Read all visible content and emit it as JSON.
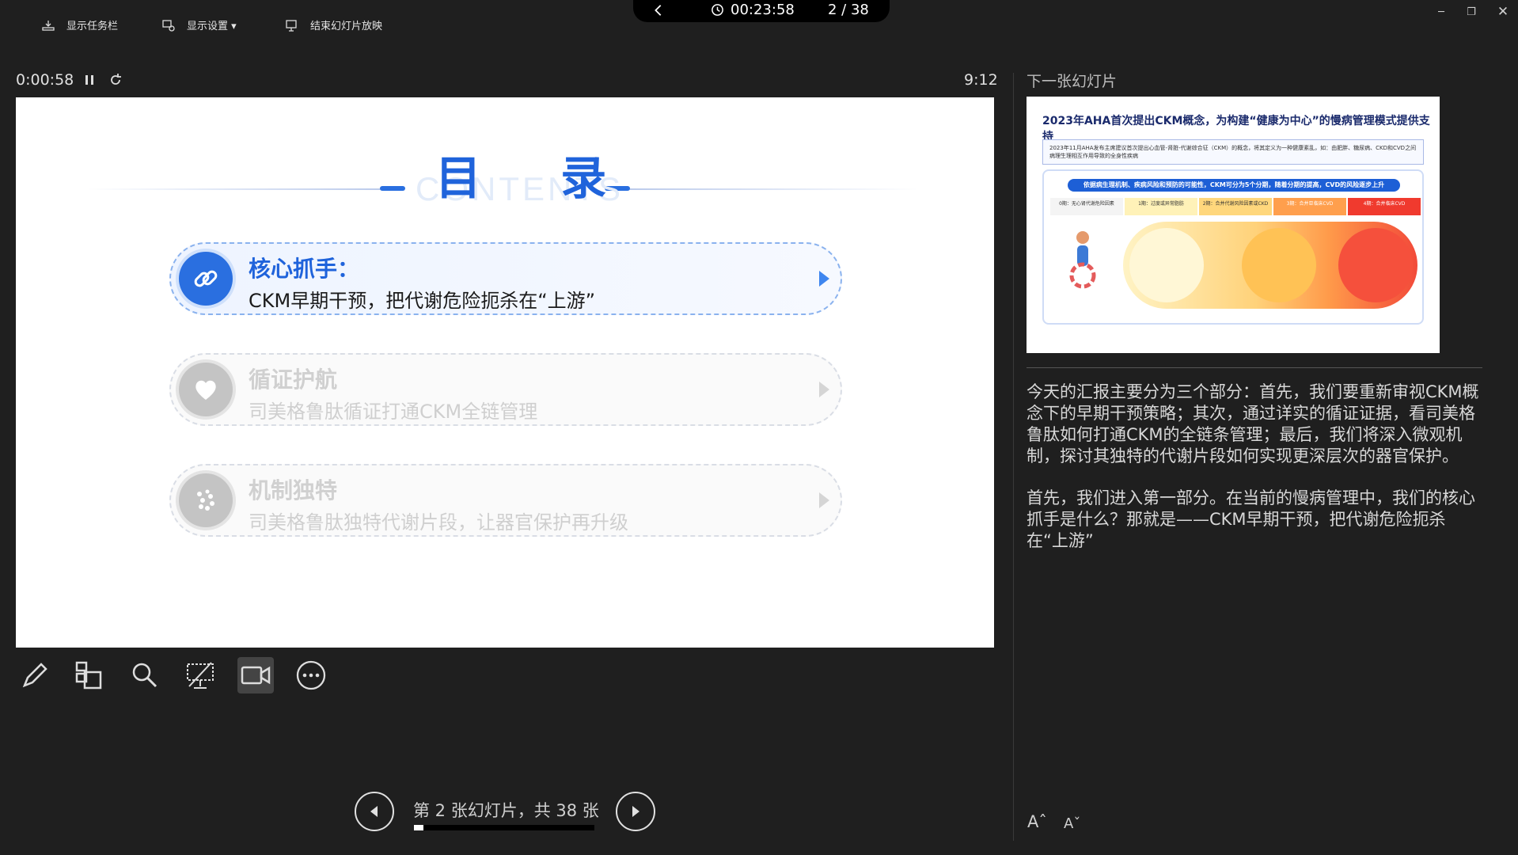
{
  "toolbar": {
    "taskbar_label": "显示任务栏",
    "display_label": "显示设置 ▾",
    "end_label": "结束幻灯片放映",
    "total_time": "00:23:58",
    "slide_counter": "2 / 38"
  },
  "timer": {
    "elapsed": "0:00:58",
    "clock": "9:12"
  },
  "slide": {
    "title": "目 录",
    "subtitle": "CONTENTS",
    "items": [
      {
        "heading": "核心抓手：",
        "sub": "CKM早期干预，把代谢危险扼杀在“上游”",
        "active": true
      },
      {
        "heading": "循证护航",
        "sub": "司美格鲁肽循证打通CKM全链管理",
        "active": false
      },
      {
        "heading": "机制独特",
        "sub": "司美格鲁肽独特代谢片段，让器官保护再升级",
        "active": false
      }
    ]
  },
  "nav": {
    "label": "第 2 张幻灯片，共 38 张",
    "progress": 0.053
  },
  "next": {
    "label": "下一张幻灯片",
    "title": "2023年AHA首次提出CKM概念，为构建“健康为中心”的慢病管理模式提供支持",
    "box_text": "2023年11月AHA发布主席建议首次提出心血管-肾脏-代谢综合征（CKM）的概念，将其定义为一种健康紊乱，如：由肥胖、糖尿病、CKD和CVD之间病理生理相互作用导致的全身性疾病",
    "banner": "依据病生理机制、疾病风险和预防的可能性，CKM可分为5个分期，随着分期的提高，CVD的风险逐步上升",
    "stages": [
      "0期：无心肾代谢危险因素",
      "1期：过度或异常脂肪",
      "2期：合并代谢风险因素或CKD",
      "3期：合并亚临床CVD",
      "4期：合并临床CVD"
    ],
    "stage_colors": [
      "#f4f4f4",
      "#fff2b8",
      "#ffd77c",
      "#ff9f4d",
      "#f03a2e"
    ]
  },
  "notes": {
    "p1": "今天的汇报主要分为三个部分：首先，我们要重新审视CKM概念下的早期干预策略；其次，通过详实的循证证据，看司美格鲁肽如何打通CKM的全链条管理；最后，我们将深入微观机制，探讨其独特的代谢片段如何实现更深层次的器官保护。",
    "p2": "首先，我们进入第一部分。在当前的慢病管理中，我们的核心抓手是什么？那就是——CKM早期干预，把代谢危险扼杀在“上游”"
  },
  "font_controls": {
    "up": "Aˆ",
    "down": "Aˇ"
  }
}
